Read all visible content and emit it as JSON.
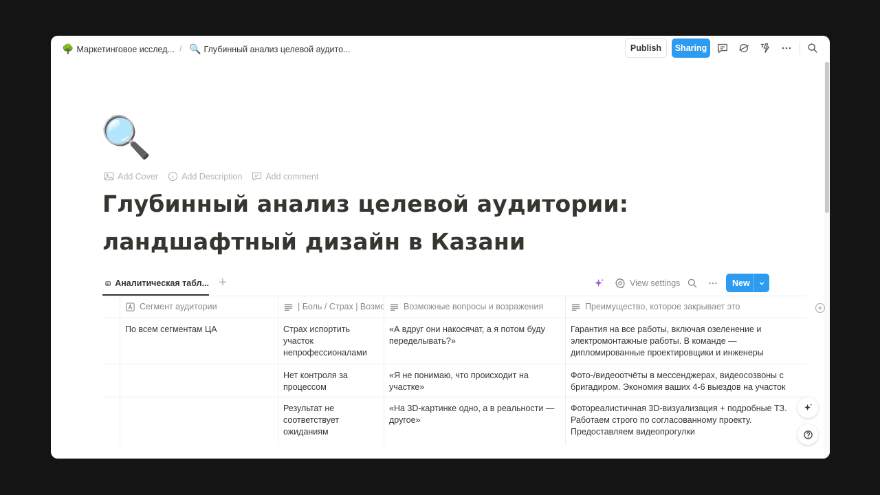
{
  "breadcrumb": {
    "items": [
      {
        "emoji": "🌳",
        "label": "Маркетинговое исслед..."
      },
      {
        "emoji": "🔍",
        "label": "Глубинный анализ целевой аудито..."
      }
    ],
    "separator": "/"
  },
  "topbar": {
    "publish_label": "Publish",
    "sharing_label": "Sharing",
    "sharing_color": "#2d9cf0",
    "icons": [
      "comment-icon",
      "sync-icon",
      "automation-icon",
      "more-icon",
      "search-icon"
    ]
  },
  "page": {
    "icon": "🔍",
    "actions": [
      {
        "icon": "image-icon",
        "label": "Add Cover"
      },
      {
        "icon": "info-icon",
        "label": "Add Description"
      },
      {
        "icon": "comment-icon",
        "label": "Add comment"
      }
    ],
    "title": "Глубинный анализ целевой аудитории: ландшафтный дизайн в Казани"
  },
  "database": {
    "view_tab": "Аналитическая табл...",
    "view_settings_label": "View settings",
    "new_label": "New",
    "columns": [
      {
        "icon": "text-type-icon",
        "label": "Сегмент аудитории"
      },
      {
        "icon": "lines-icon",
        "label": "| Боль / Страх | Возмо"
      },
      {
        "icon": "lines-icon",
        "label": "Возможные вопросы и возражения"
      },
      {
        "icon": "lines-icon",
        "label": "Преимущество, которое закрывает это"
      }
    ],
    "rows": [
      {
        "segment": "По всем сегментам ЦА",
        "pain": "Страх испортить участок непрофессионалами",
        "question": "«А вдруг они накосячат, а я потом буду переделывать?»",
        "advantage": "Гарантия на все работы, включая озеленение и электромонтажные работы. В команде — дипломированные проектировщики и инженеры"
      },
      {
        "segment": "",
        "pain": "Нет контроля за процессом",
        "question": "«Я не понимаю, что происходит на участке»",
        "advantage": "Фото-/видеоотчёты в мессенджерах, видеосозвоны с бригадиром. Экономия ваших 4-6 выездов на участок"
      },
      {
        "segment": "",
        "pain": "Результат не соответствует ожиданиям",
        "question": "«На 3D-картинке одно, а в реальности — другое»",
        "advantage": "Фотореалистичная 3D-визуализация + подробные ТЗ. Работаем строго по согласованному проекту. Предоставляем видеопрогулки"
      }
    ]
  }
}
